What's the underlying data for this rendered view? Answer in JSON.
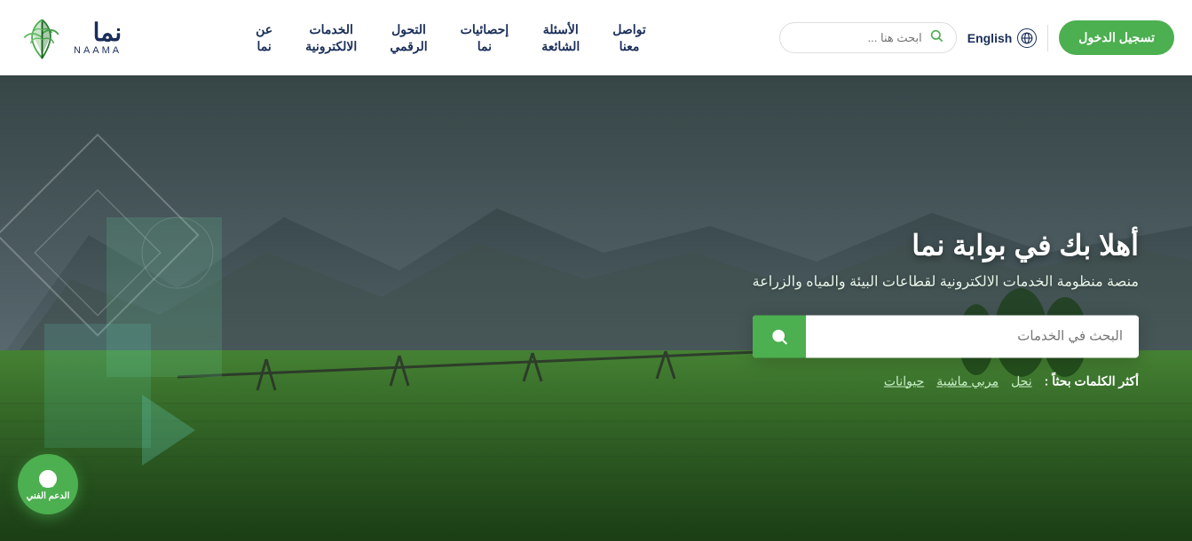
{
  "header": {
    "logo": {
      "name_ar": "نما",
      "name_en": "NAAMA"
    },
    "nav": [
      {
        "id": "about",
        "label": "عن\nنما"
      },
      {
        "id": "eservices",
        "label": "الخدمات\nالالكترونية"
      },
      {
        "id": "digital",
        "label": "التحول\nالرقمي"
      },
      {
        "id": "statistics",
        "label": "إحصائيات\nنما"
      },
      {
        "id": "faq",
        "label": "الأسئلة\nالشائعة"
      },
      {
        "id": "contact",
        "label": "تواصل\nمعنا"
      }
    ],
    "search": {
      "placeholder": "ابحث هنا ..."
    },
    "language": {
      "label": "English"
    },
    "login": {
      "label": "تسجيل\nالدخول"
    }
  },
  "hero": {
    "title": "أهلا بك في بوابة نما",
    "subtitle": "منصة منظومة الخدمات الالكترونية لقطاعات البيئة والمياه والزراعة",
    "search": {
      "placeholder": "البحث في الخدمات"
    },
    "tags": {
      "label": "أكثر الكلمات بحثاً :",
      "items": [
        "حيوانات",
        "مربي ماشية",
        "نحل"
      ]
    }
  },
  "support": {
    "label": "الدعم الفني"
  }
}
